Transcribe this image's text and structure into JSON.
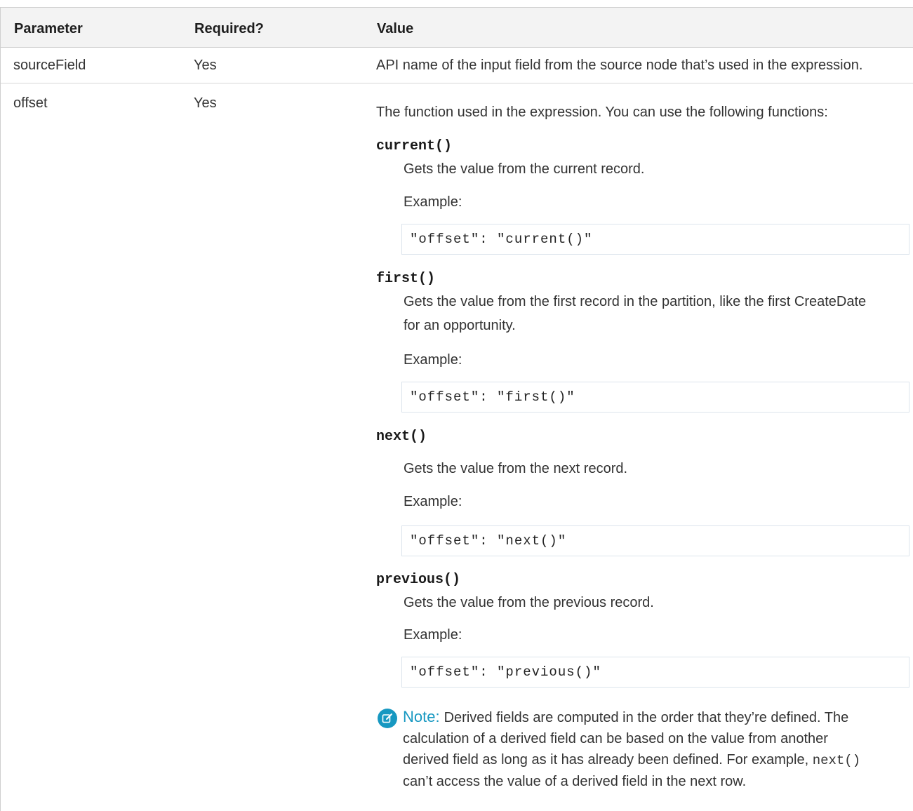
{
  "table": {
    "headers": {
      "parameter": "Parameter",
      "required": "Required?",
      "value": "Value"
    },
    "rows": [
      {
        "parameter": "sourceField",
        "required": "Yes",
        "value": "API name of the input field from the source node that’s used in the expression."
      },
      {
        "parameter": "offset",
        "required": "Yes",
        "value_intro": "The function used in the expression. You can use the following functions:",
        "functions": [
          {
            "name": "current()",
            "description_line1": "Gets the value from the current record.",
            "description_line2": "",
            "example_label": "Example:",
            "code": "\"offset\": \"current()\""
          },
          {
            "name": "first()",
            "description_line1": "Gets the value from the first record in the partition, like the first CreateDate",
            "description_line2": "for an opportunity.",
            "example_label": "Example:",
            "code": "\"offset\": \"first()\""
          },
          {
            "name": "next()",
            "description_line1": "Gets the value from the next record.",
            "description_line2": "",
            "example_label": "Example:",
            "code": "\"offset\": \"next()\""
          },
          {
            "name": "previous()",
            "description_line1": "Gets the value from the previous record.",
            "description_line2": "",
            "example_label": "Example:",
            "code": "\"offset\": \"previous()\""
          }
        ],
        "note": {
          "label": "Note:",
          "line1": "Derived fields are computed in the order that they’re defined. The",
          "line2": "calculation of a derived field can be based on the value from another",
          "line3_prefix": "derived field as long as it has already been defined. For example,",
          "line3_code": "next()",
          "line4": "can’t access the value of a derived field in the next row."
        }
      }
    ]
  },
  "colors": {
    "header_bg": "#f3f3f3",
    "note_accent": "#1798c1",
    "code_border": "#dce4ec"
  },
  "icons": {
    "note": "edit-note-icon"
  }
}
